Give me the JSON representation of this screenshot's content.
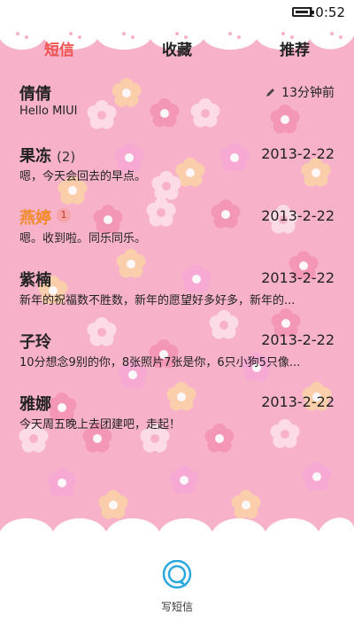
{
  "status_bar": {
    "time": "10:52"
  },
  "tabs": [
    {
      "label": "短信",
      "active": true
    },
    {
      "label": "收藏",
      "active": false
    },
    {
      "label": "推荐",
      "active": false
    }
  ],
  "conversations": [
    {
      "name": "倩倩",
      "count": "",
      "unread": "",
      "preview": "Hello MIUI",
      "time": "13分钟前",
      "draft": true
    },
    {
      "name": "果冻",
      "count": "(2)",
      "unread": "",
      "preview": "嗯，今天会回去的早点。",
      "time": "2013-2-22",
      "draft": false
    },
    {
      "name": "燕婷",
      "count": "",
      "unread": "1",
      "preview": "嗯。收到啦。同乐同乐。",
      "time": "2013-2-22",
      "draft": false
    },
    {
      "name": "紫楠",
      "count": "",
      "unread": "",
      "preview": "新年的祝福数不胜数，新年的愿望好多好多，新年的...",
      "time": "2013-2-22",
      "draft": false
    },
    {
      "name": "子玲",
      "count": "",
      "unread": "",
      "preview": "10分想念9别的你，8张照片7张是你，6只小狗5只像...",
      "time": "2013-2-22",
      "draft": false
    },
    {
      "name": "雅娜",
      "count": "",
      "unread": "",
      "preview": "今天周五晚上去团建吧，走起！",
      "time": "2013-2-22",
      "draft": false
    }
  ],
  "compose": {
    "label": "写短信"
  },
  "colors": {
    "accent": "#f0524f",
    "background": "#f7b2c9",
    "unread_name": "#f08a2a"
  }
}
